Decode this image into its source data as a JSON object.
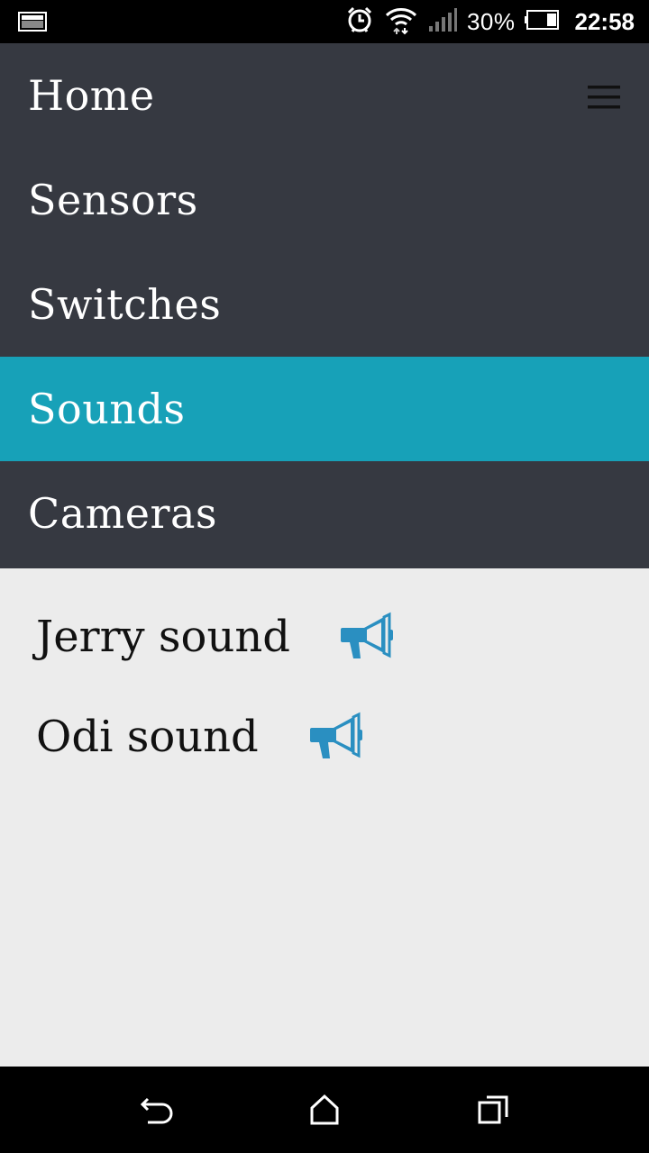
{
  "status_bar": {
    "battery_percent": "30%",
    "time": "22:58",
    "icons": [
      "screenshot-icon",
      "alarm-icon",
      "wifi-icon",
      "signal-icon",
      "battery-icon"
    ]
  },
  "nav": {
    "items": [
      {
        "label": "Home",
        "active": false
      },
      {
        "label": "Sensors",
        "active": false
      },
      {
        "label": "Switches",
        "active": false
      },
      {
        "label": "Sounds",
        "active": true
      },
      {
        "label": "Cameras",
        "active": false
      }
    ],
    "menu_icon": "menu-icon",
    "background": "#363941",
    "active_color": "#17a1b8"
  },
  "sounds": {
    "items": [
      {
        "label": "Jerry sound",
        "icon": "megaphone-icon"
      },
      {
        "label": "Odi sound",
        "icon": "megaphone-icon"
      }
    ],
    "icon_color": "#2a8fc1"
  },
  "system_nav": {
    "icons": [
      "back-icon",
      "home-icon",
      "recents-icon"
    ]
  }
}
